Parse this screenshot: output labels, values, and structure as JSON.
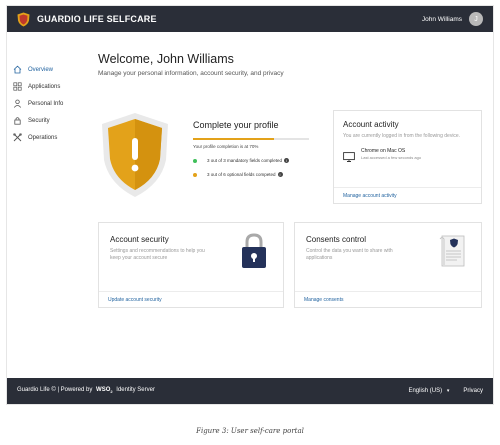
{
  "header": {
    "brand": "GUARDIO LIFE SELFCARE",
    "user_name": "John Williams",
    "avatar_initial": "J"
  },
  "sidebar": {
    "items": [
      {
        "label": "Overview",
        "icon": "home-icon",
        "active": true
      },
      {
        "label": "Applications",
        "icon": "grid-icon",
        "active": false
      },
      {
        "label": "Personal Info",
        "icon": "user-icon",
        "active": false
      },
      {
        "label": "Security",
        "icon": "lock-icon",
        "active": false
      },
      {
        "label": "Operations",
        "icon": "tools-icon",
        "active": false
      }
    ]
  },
  "main": {
    "welcome": "Welcome, John Williams",
    "subtitle": "Manage your personal information, account security, and privacy"
  },
  "profile": {
    "title": "Complete your profile",
    "progress_percent": 70,
    "progress_note": "Your profile completion is at 70%",
    "mandatory": "3 out of 3 mandatory fields completed",
    "optional": "3 out of 6 optional fields competed"
  },
  "activity": {
    "title": "Account activity",
    "desc": "You are currently logged in from the following device.",
    "device": "Chrome on Mac OS",
    "last_access": "Last accessed a few seconds ago",
    "link": "Manage account activity"
  },
  "security": {
    "title": "Account security",
    "desc": "Settings and recommendations to help you keep your account secure",
    "link": "Update account security"
  },
  "consents": {
    "title": "Consents control",
    "desc": "Control the data you want to share with applications",
    "link": "Manage consents"
  },
  "footer": {
    "left_prefix": "Guardio Life © | Powered by",
    "vendor": "WSO",
    "vendor_sub": "2",
    "product": "Identity Server",
    "language": "English (US)",
    "privacy": "Privacy"
  },
  "caption": "Figure 3: User self-care portal",
  "colors": {
    "dark_bar": "#2a2e38",
    "accent": "#e3a21a",
    "link": "#2364a0",
    "green": "#3fbf5a",
    "navy": "#24325a"
  }
}
